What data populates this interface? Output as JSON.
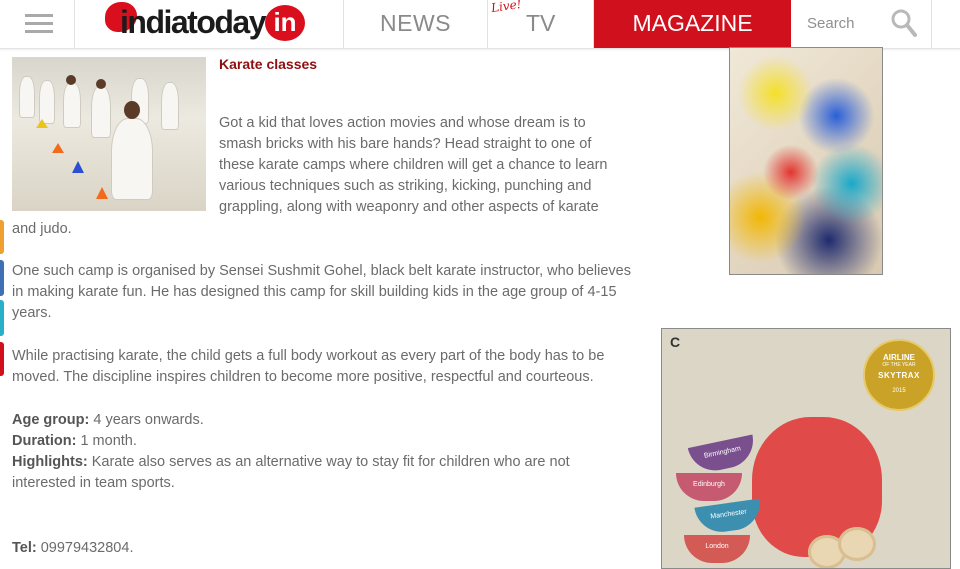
{
  "header": {
    "logo_text": "indiatoday",
    "logo_suffix": "in",
    "nav": {
      "news": "NEWS",
      "tv_live": "Live!",
      "tv": "TV",
      "magazine": "MAGAZINE"
    },
    "search": {
      "placeholder": "Search"
    },
    "colors": {
      "brand_red": "#d0101c",
      "nav_text": "#8a8a8a"
    }
  },
  "article": {
    "title": "Karate classes",
    "p1_lines": [
      "Got a kid that loves action movies and whose dream is to",
      "smash bricks with his bare hands? Head straight to one of",
      "these karate camps where children will get a chance to learn",
      "various techniques such as striking, kicking, punching and",
      "grappling, along with weaponry and other aspects of karate"
    ],
    "p1_tail": "and judo.",
    "p2": "One such camp is organised by Sensei Sushmit Gohel, black belt karate instructor, who believes in making karate fun. He has designed this camp for skill building kids in the age group of 4-15 years.",
    "p3": "While practising karate, the child gets a full body workout as every part of the body has to be moved. The discipline inspires children to become more positive, respectful and courteous.",
    "details": {
      "age_label": "Age group:",
      "age_value": " 4 years onwards.",
      "duration_label": "Duration:",
      "duration_value": " 1 month.",
      "highlights_label": "Highlights:",
      "highlights_value": " Karate also serves as an alternative way to stay fit for children who are not interested in team sports."
    },
    "tel_label": "Tel:",
    "tel_value": " 09979432804."
  },
  "ads": {
    "ad2_choice": "C",
    "badge": {
      "line1": "AIRLINE",
      "line2": "OF THE YEAR",
      "line3": "SKYTRAX",
      "line4": "2015"
    },
    "cups": [
      "Birmingham",
      "Edinburgh",
      "Manchester",
      "London"
    ]
  },
  "side_marks_colors": [
    "#f0a030",
    "#3f6fb5",
    "#29b0c9",
    "#d0101c"
  ]
}
